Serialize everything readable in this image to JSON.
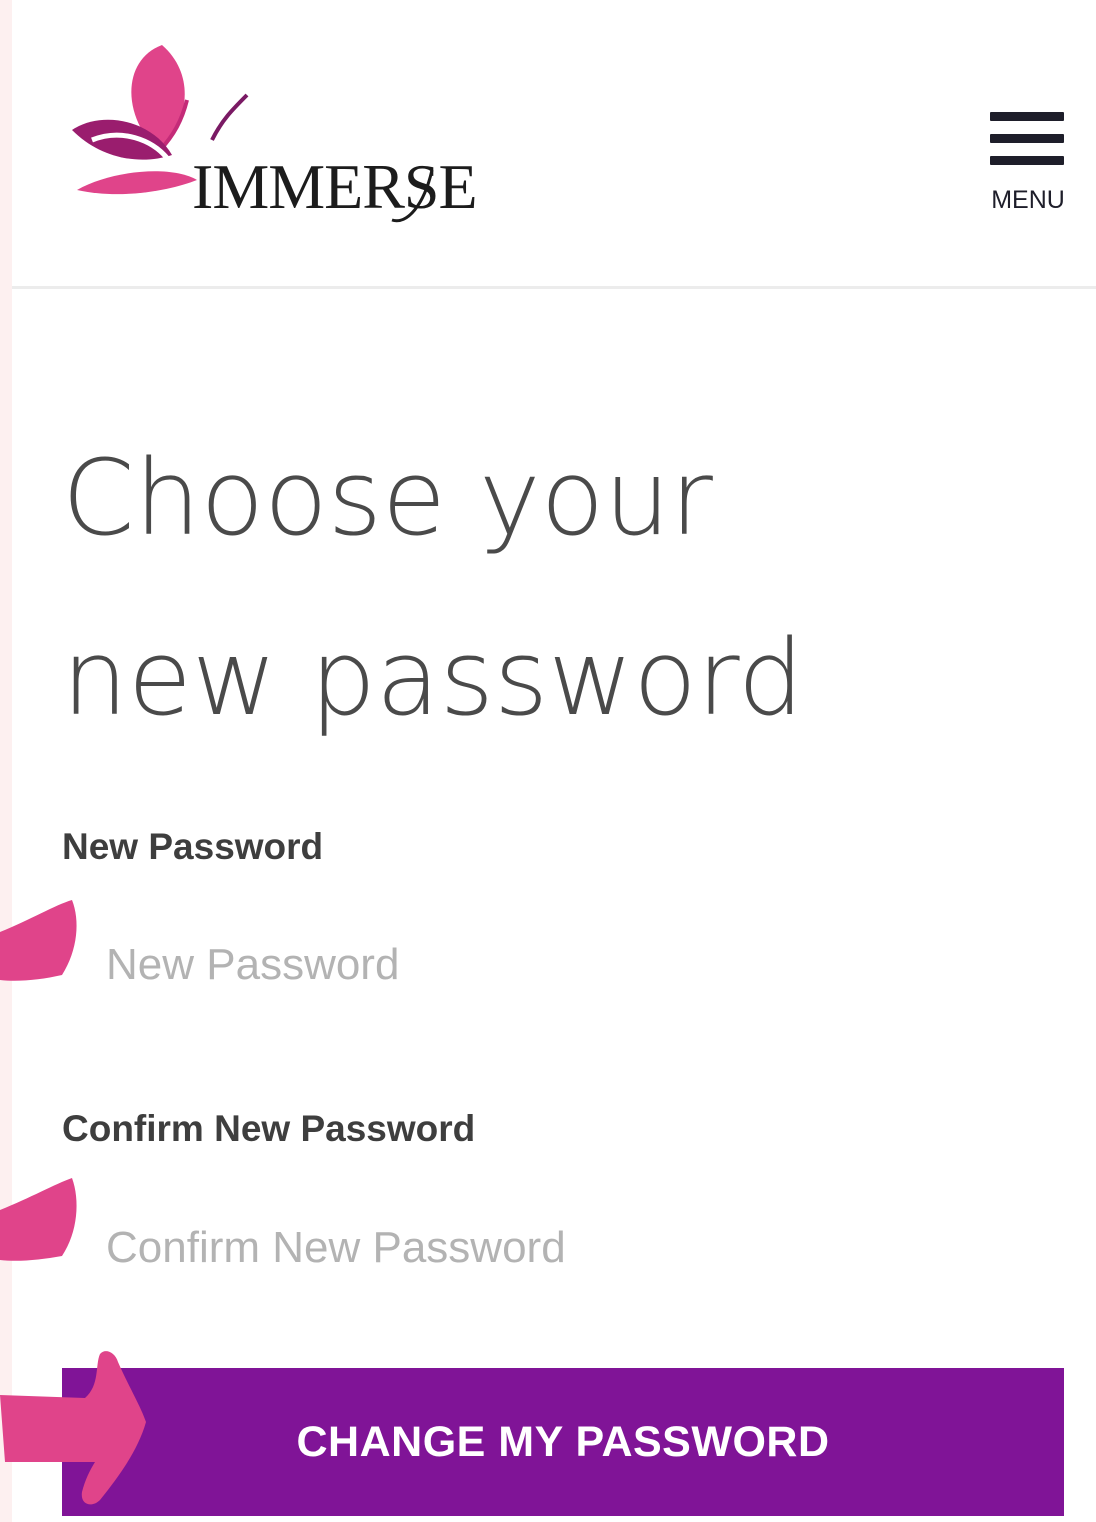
{
  "brand": {
    "name": "IMMERSE",
    "primary": "#801497",
    "accent": "#e0448a"
  },
  "header": {
    "menu_label": "MENU"
  },
  "main": {
    "title_line1": "Choose your",
    "title_line2": "new password",
    "new_password": {
      "label": "New Password",
      "placeholder": "New Password"
    },
    "confirm_password": {
      "label": "Confirm New Password",
      "placeholder": "Confirm New Password"
    },
    "submit_label": "CHANGE MY PASSWORD"
  },
  "annotations": {
    "arrow_color": "#e0448a"
  }
}
